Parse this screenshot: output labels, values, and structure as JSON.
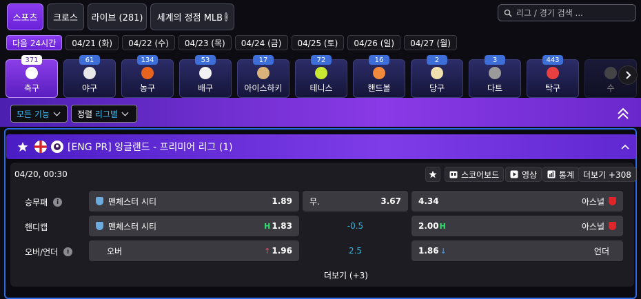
{
  "top_tabs": [
    {
      "label": "스포츠",
      "active": true
    },
    {
      "label": "크로스",
      "active": false
    },
    {
      "label": "라이브 (281)",
      "active": false
    },
    {
      "label": "세계의 정점 MLB",
      "active": false
    }
  ],
  "search": {
    "placeholder": "리그 / 경기 검색 ..."
  },
  "dates": [
    "다음 24시간",
    "04/21 (화)",
    "04/22 (수)",
    "04/23 (목)",
    "04/24 (금)",
    "04/25 (토)",
    "04/26 (일)",
    "04/27 (월)"
  ],
  "sports": [
    {
      "label": "축구",
      "count": "371",
      "icon": "soccer-ball-icon",
      "color": "#ffffff",
      "active": true
    },
    {
      "label": "야구",
      "count": "61",
      "icon": "baseball-icon",
      "color": "#e8e8e8"
    },
    {
      "label": "농구",
      "count": "134",
      "icon": "basketball-icon",
      "color": "#e8641e"
    },
    {
      "label": "배구",
      "count": "53",
      "icon": "volleyball-icon",
      "color": "#f2f2f2"
    },
    {
      "label": "아이스하키",
      "count": "17",
      "icon": "hockey-stick-icon",
      "color": "#d9b37a"
    },
    {
      "label": "테니스",
      "count": "72",
      "icon": "tennis-ball-icon",
      "color": "#c8e832"
    },
    {
      "label": "핸드볼",
      "count": "16",
      "icon": "handball-icon",
      "color": "#f08a3c"
    },
    {
      "label": "당구",
      "count": "2",
      "icon": "billiards-icon",
      "color": "#f0e0b0"
    },
    {
      "label": "다트",
      "count": "3",
      "icon": "dartboard-icon",
      "color": "#9a9a9a"
    },
    {
      "label": "탁구",
      "count": "443",
      "icon": "table-tennis-icon",
      "color": "#e84040"
    },
    {
      "label": "수",
      "count": "",
      "icon": "partial-sport-icon",
      "color": "#888888"
    }
  ],
  "filters": {
    "all_features": "모든 기능",
    "sort_label": "정렬",
    "sort_value": "리그별"
  },
  "league": {
    "title": "[ENG PR] 잉글랜드 - 프리미어 리그 (1)"
  },
  "match": {
    "time": "04/20, 00:30",
    "buttons": {
      "scoreboard": "스코어보드",
      "video": "영상",
      "stats": "통계",
      "more": "더보기 +308"
    },
    "markets": [
      {
        "label": "승무패",
        "has_info": true,
        "home": "맨체스터 시티",
        "home_odds": "1.89",
        "draw_label": "무.",
        "draw_odds": "3.67",
        "away_odds": "4.34",
        "away": "아스널"
      },
      {
        "label": "핸디캡",
        "has_info": false,
        "home": "맨체스터 시티",
        "home_odds": "1.83",
        "home_tag": "H",
        "line": "-0.5",
        "away_odds": "2.00",
        "away_tag": "H",
        "away": "아스널"
      },
      {
        "label": "오버/언더",
        "has_info": true,
        "home": "오버",
        "home_odds": "1.96",
        "line": "2.5",
        "away_odds": "1.86",
        "away": "언더"
      }
    ],
    "more_label": "더보기 (+3)"
  },
  "colors": {
    "accent": "#8a3cf0",
    "blue": "#2d6be6",
    "line": "#2fb8e6",
    "up": "#ff4d6d",
    "down": "#3aa0ff"
  }
}
